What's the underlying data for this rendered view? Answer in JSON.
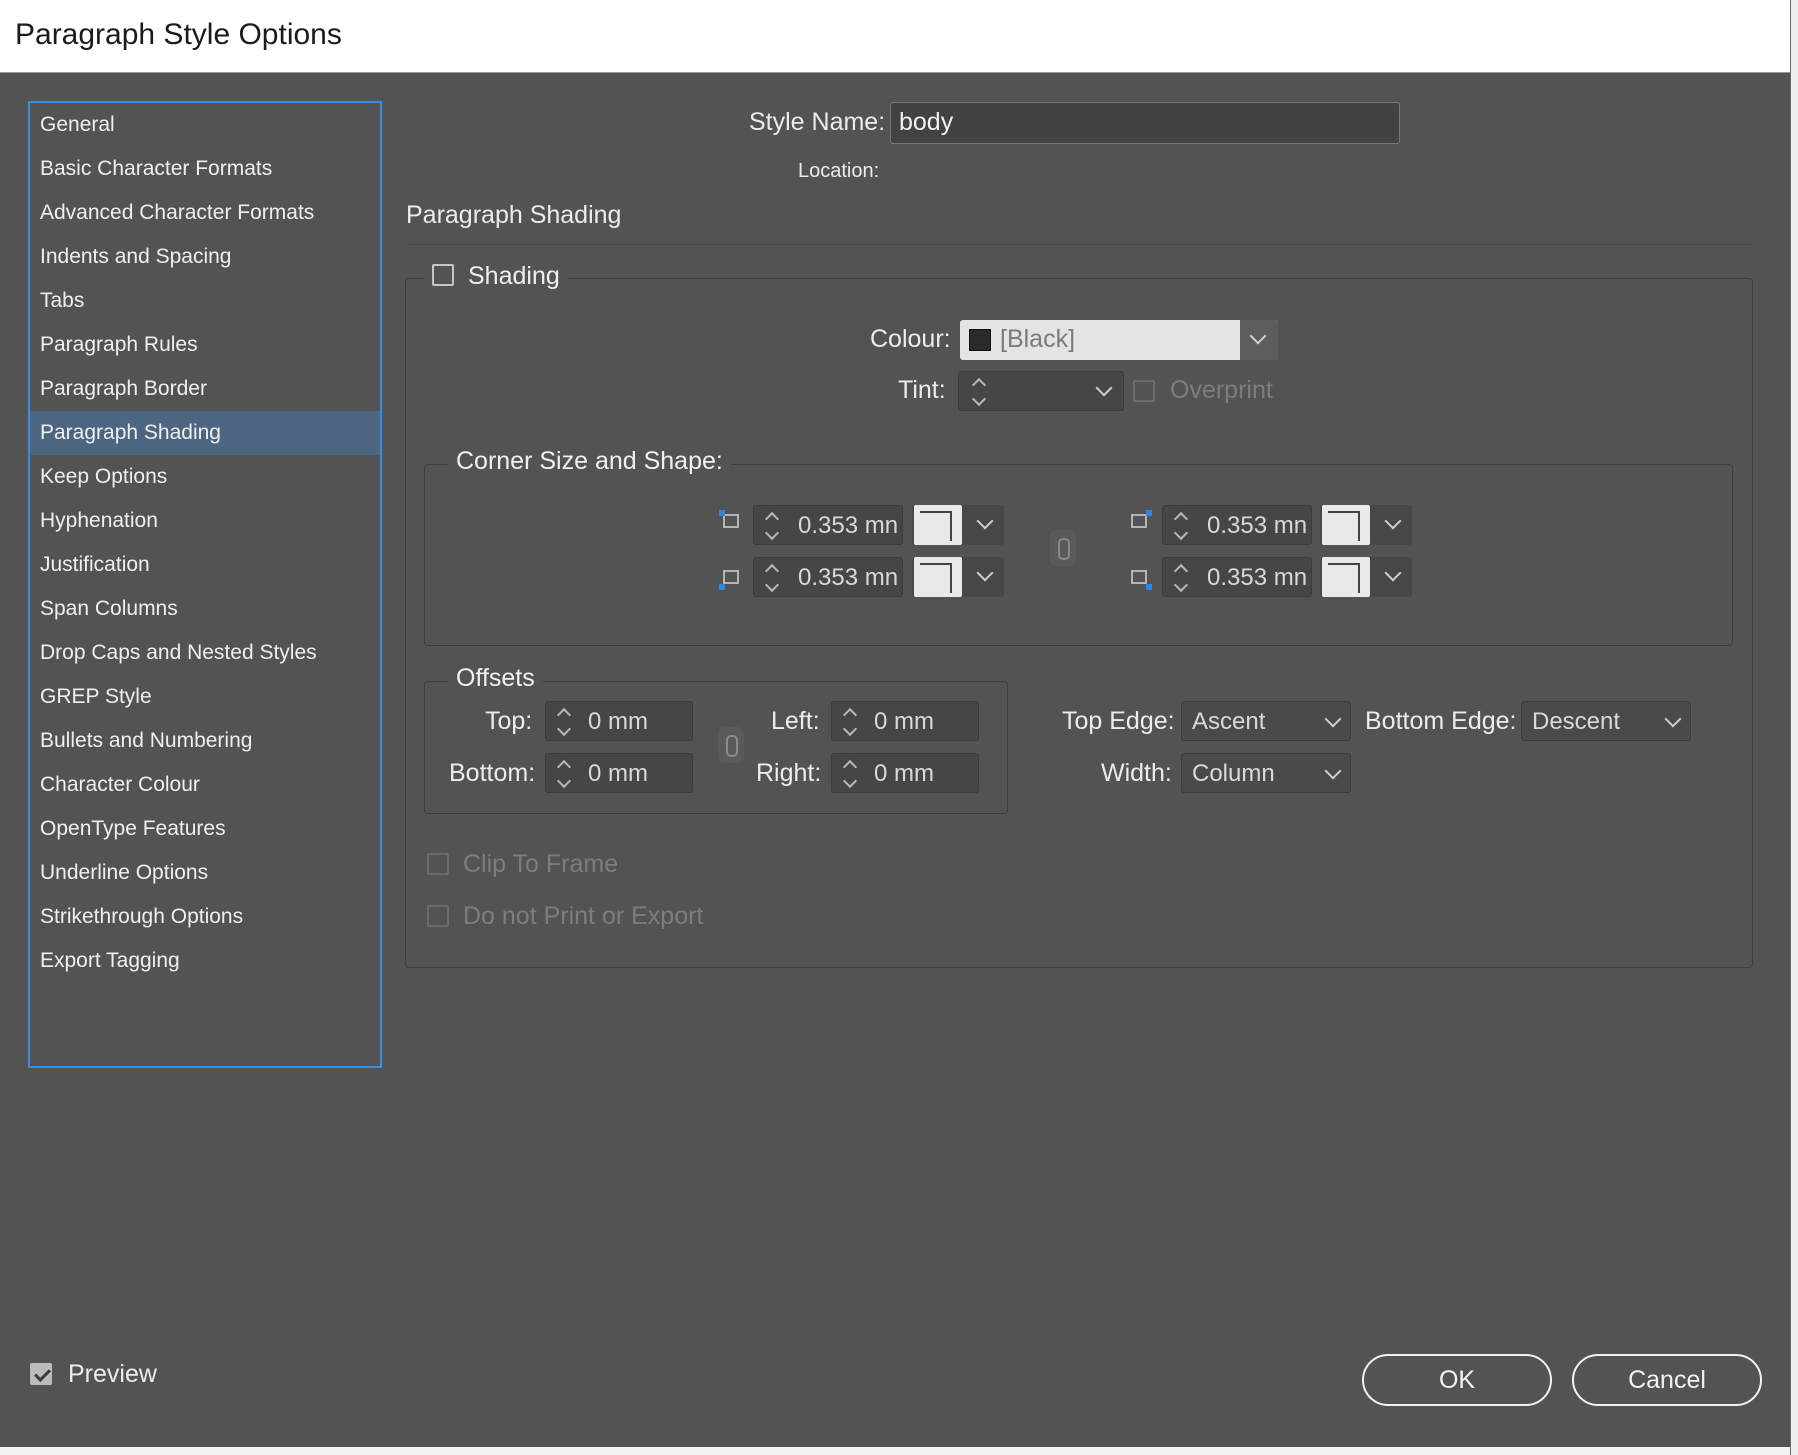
{
  "window": {
    "title": "Paragraph Style Options"
  },
  "sidebar": {
    "items": [
      {
        "label": "General"
      },
      {
        "label": "Basic Character Formats"
      },
      {
        "label": "Advanced Character Formats"
      },
      {
        "label": "Indents and Spacing"
      },
      {
        "label": "Tabs"
      },
      {
        "label": "Paragraph Rules"
      },
      {
        "label": "Paragraph Border"
      },
      {
        "label": "Paragraph Shading",
        "selected": true
      },
      {
        "label": "Keep Options"
      },
      {
        "label": "Hyphenation"
      },
      {
        "label": "Justification"
      },
      {
        "label": "Span Columns"
      },
      {
        "label": "Drop Caps and Nested Styles"
      },
      {
        "label": "GREP Style"
      },
      {
        "label": "Bullets and Numbering"
      },
      {
        "label": "Character Colour"
      },
      {
        "label": "OpenType Features"
      },
      {
        "label": "Underline Options"
      },
      {
        "label": "Strikethrough Options"
      },
      {
        "label": "Export Tagging"
      }
    ]
  },
  "header": {
    "style_name_label": "Style Name:",
    "style_name_value": "body",
    "location_label": "Location:",
    "section_title": "Paragraph Shading"
  },
  "shading": {
    "label": "Shading",
    "checked": false,
    "colour_label": "Colour:",
    "colour_value": "[Black]",
    "colour_swatch": "#2a2a2a",
    "tint_label": "Tint:",
    "tint_value": "",
    "overprint_label": "Overprint"
  },
  "corners": {
    "legend": "Corner Size and Shape:",
    "top_left": "0.353 mn",
    "bottom_left": "0.353 mn",
    "top_right": "0.353 mn",
    "bottom_right": "0.353 mn",
    "icons": [
      "corner-top-left-icon",
      "corner-bottom-left-icon",
      "corner-top-right-icon",
      "corner-bottom-right-icon"
    ]
  },
  "offsets": {
    "legend": "Offsets",
    "top_label": "Top:",
    "top_value": "0 mm",
    "bottom_label": "Bottom:",
    "bottom_value": "0 mm",
    "left_label": "Left:",
    "left_value": "0 mm",
    "right_label": "Right:",
    "right_value": "0 mm"
  },
  "edges": {
    "top_edge_label": "Top Edge:",
    "top_edge_value": "Ascent",
    "bottom_edge_label": "Bottom Edge:",
    "bottom_edge_value": "Descent",
    "width_label": "Width:",
    "width_value": "Column"
  },
  "options": {
    "clip_to_frame": "Clip To Frame",
    "do_not_print": "Do not Print or Export"
  },
  "footer": {
    "preview_label": "Preview",
    "preview_checked": true,
    "ok_label": "OK",
    "cancel_label": "Cancel"
  },
  "colors": {
    "dialog_bg": "#535353",
    "selection": "#4c6581",
    "focus_border": "#3b8de0",
    "corner_icon_accent": "#2f86e0"
  }
}
